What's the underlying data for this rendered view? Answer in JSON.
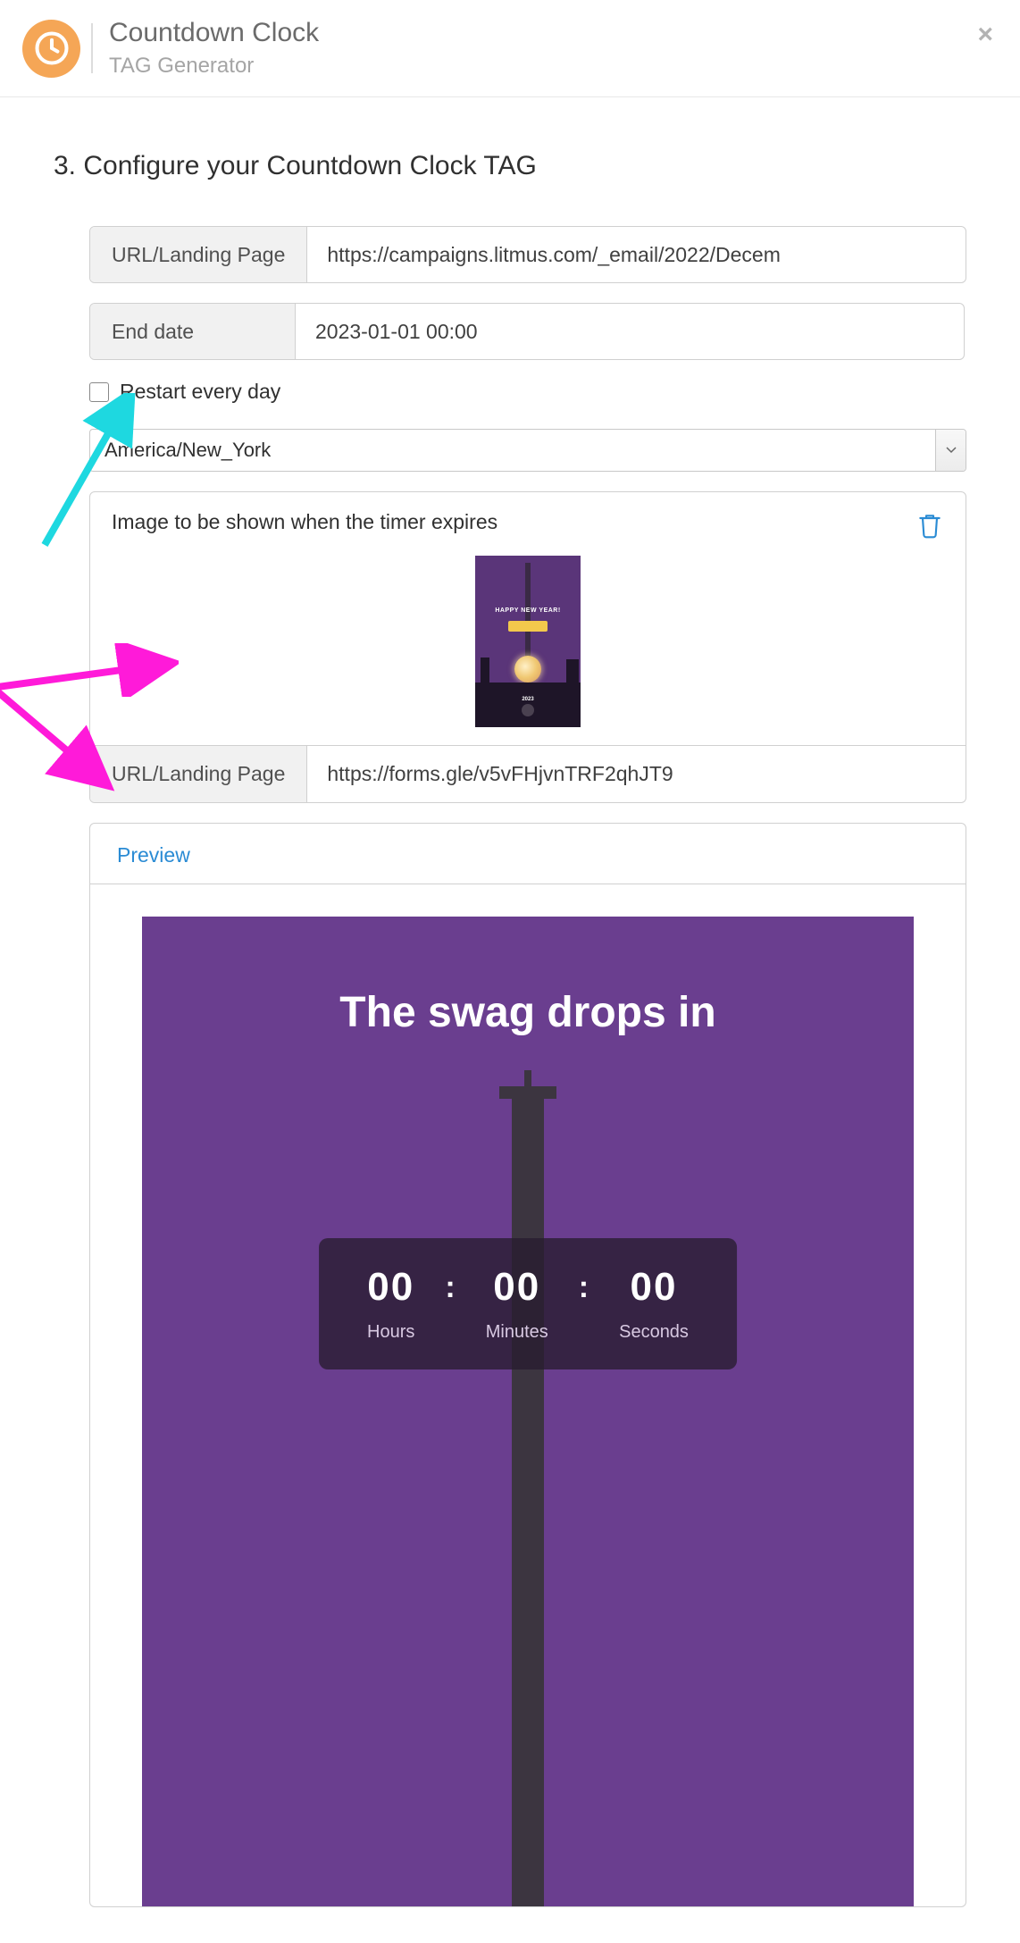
{
  "header": {
    "title": "Countdown Clock",
    "subtitle": "TAG Generator"
  },
  "section_heading": "3. Configure your Countdown Clock TAG",
  "form": {
    "url_label": "URL/Landing Page",
    "url_value": "https://campaigns.litmus.com/_email/2022/Decem",
    "enddate_label": "End date",
    "enddate_value": "2023-01-01 00:00",
    "restart_label": "Restart every day",
    "timezone_value": "America/New_York",
    "expire_image_label": "Image to be shown when the timer expires",
    "thumb_text": "HAPPY NEW YEAR!",
    "thumb_year": "2023",
    "url2_label": "URL/Landing Page",
    "url2_value": "https://forms.gle/v5vFHjvnTRF2qhJT9"
  },
  "preview": {
    "tab_label": "Preview",
    "heading": "The swag drops in",
    "hours_value": "00",
    "hours_label": "Hours",
    "minutes_value": "00",
    "minutes_label": "Minutes",
    "seconds_value": "00",
    "seconds_label": "Seconds",
    "separator": ":"
  },
  "colors": {
    "accent": "#f5a656",
    "preview_bg": "#6a3e8f",
    "annotation_cyan": "#1ed8e0",
    "annotation_magenta": "#ff1ad9"
  }
}
